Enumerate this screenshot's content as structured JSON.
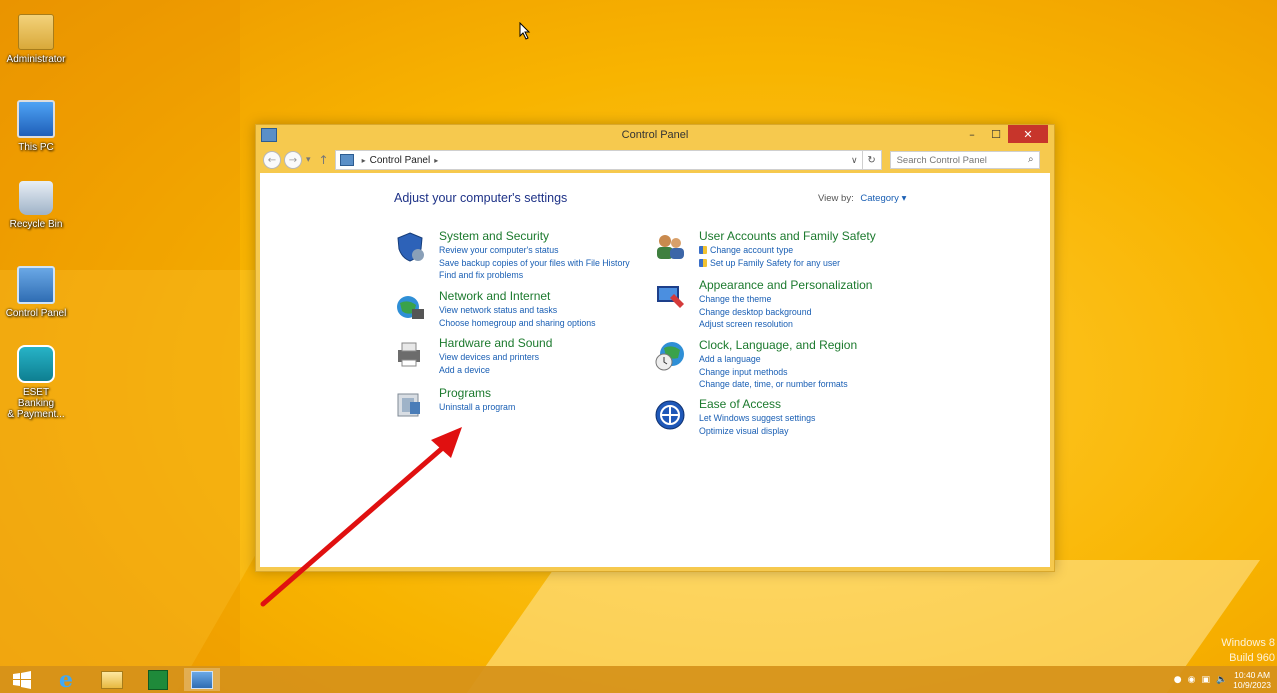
{
  "desktop": {
    "icons": [
      {
        "label": "Administrator",
        "icon": "user-folder-icon"
      },
      {
        "label": "This PC",
        "icon": "computer-icon"
      },
      {
        "label": "Recycle Bin",
        "icon": "recycle-bin-icon"
      },
      {
        "label": "Control Panel",
        "icon": "control-panel-icon"
      },
      {
        "label": "ESET Banking\n& Payment...",
        "icon": "eset-shield-icon"
      }
    ]
  },
  "window": {
    "title": "Control Panel",
    "controls": {
      "minimize": "–",
      "maximize": "☐",
      "close": "✕"
    }
  },
  "address": {
    "crumb": "Control Panel",
    "search_placeholder": "Search Control Panel"
  },
  "content": {
    "page_title": "Adjust your computer's settings",
    "view_by_label": "View by:",
    "view_by_value": "Category",
    "categories_left": [
      {
        "heading": "System and Security",
        "icon": "shield-icon",
        "links": [
          "Review your computer's status",
          "Save backup copies of your files with File History",
          "Find and fix problems"
        ]
      },
      {
        "heading": "Network and Internet",
        "icon": "network-globe-icon",
        "links": [
          "View network status and tasks",
          "Choose homegroup and sharing options"
        ]
      },
      {
        "heading": "Hardware and Sound",
        "icon": "printer-icon",
        "links": [
          "View devices and printers",
          "Add a device"
        ]
      },
      {
        "heading": "Programs",
        "icon": "programs-icon",
        "links": [
          "Uninstall a program"
        ]
      }
    ],
    "categories_right": [
      {
        "heading": "User Accounts and Family Safety",
        "icon": "users-icon",
        "links": [
          "Change account type",
          "Set up Family Safety for any user"
        ]
      },
      {
        "heading": "Appearance and Personalization",
        "icon": "display-icon",
        "links": [
          "Change the theme",
          "Change desktop background",
          "Adjust screen resolution"
        ]
      },
      {
        "heading": "Clock, Language, and Region",
        "icon": "clock-globe-icon",
        "links": [
          "Add a language",
          "Change input methods",
          "Change date, time, or number formats"
        ]
      },
      {
        "heading": "Ease of Access",
        "icon": "ease-of-access-icon",
        "links": [
          "Let Windows suggest settings",
          "Optimize visual display"
        ]
      }
    ]
  },
  "taskbar": {
    "clock_time": "10:40 AM",
    "clock_date": "10/9/2023"
  },
  "watermark": {
    "line1": "Windows 8",
    "line2": "Build 960"
  },
  "colors": {
    "heading_green": "#1c7a2e",
    "link_blue": "#1a5fb4",
    "arrow_red": "#e01010"
  }
}
